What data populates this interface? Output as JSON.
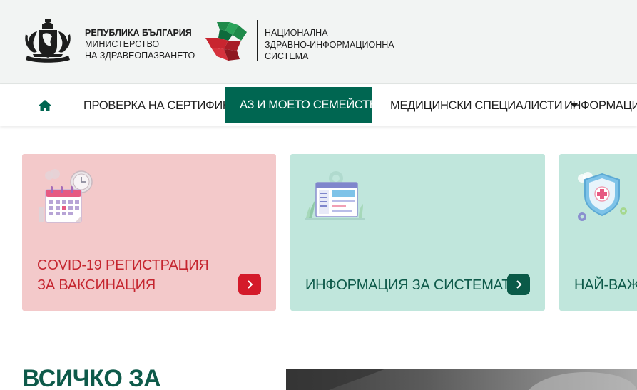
{
  "header": {
    "ministry_line1": "РЕПУБЛИКА БЪЛГАРИЯ",
    "ministry_line2": "МИНИСТЕРСТВО",
    "ministry_line3": "НА ЗДРАВЕОПАЗВАНЕТО",
    "system_line1": "НАЦИОНАЛНА",
    "system_line2": "ЗДРАВНО-ИНФОРМАЦИОННА",
    "system_line3": "СИСТЕМА"
  },
  "nav": {
    "home_icon": "home-icon",
    "items": [
      {
        "label": "ПРОВЕРКА НА СЕРТИФИКАТ",
        "dropdown": false
      },
      {
        "label": "АЗ И МОЕТО СЕМЕЙСТВО",
        "dropdown": true,
        "active": true
      },
      {
        "label": "МЕДИЦИНСКИ СПЕЦИАЛИСТИ",
        "dropdown": true
      },
      {
        "label": "ИНФОРМАЦИЯ",
        "dropdown": false
      }
    ]
  },
  "cards": [
    {
      "title": "COVID-19 РЕГИСТРАЦИЯ ЗА ВАКСИНАЦИЯ",
      "icon": "calendar-clock-icon",
      "color": "#f3c9ca",
      "accent": "#d41a2a"
    },
    {
      "title": "ИНФОРМАЦИЯ ЗА СИСТЕМАТА",
      "icon": "system-window-icon",
      "color": "#c0e6dc",
      "accent": "#0a5a48"
    },
    {
      "title": "НАЙ-ВАЖНО",
      "icon": "shield-medical-icon",
      "color": "#c0e6dc",
      "accent": "#0a5a48"
    }
  ],
  "section": {
    "title": "ВСИЧКО ЗА"
  },
  "colors": {
    "brand_green": "#006651",
    "brand_red": "#d41a2a",
    "header_bg": "#f2f4f3"
  }
}
